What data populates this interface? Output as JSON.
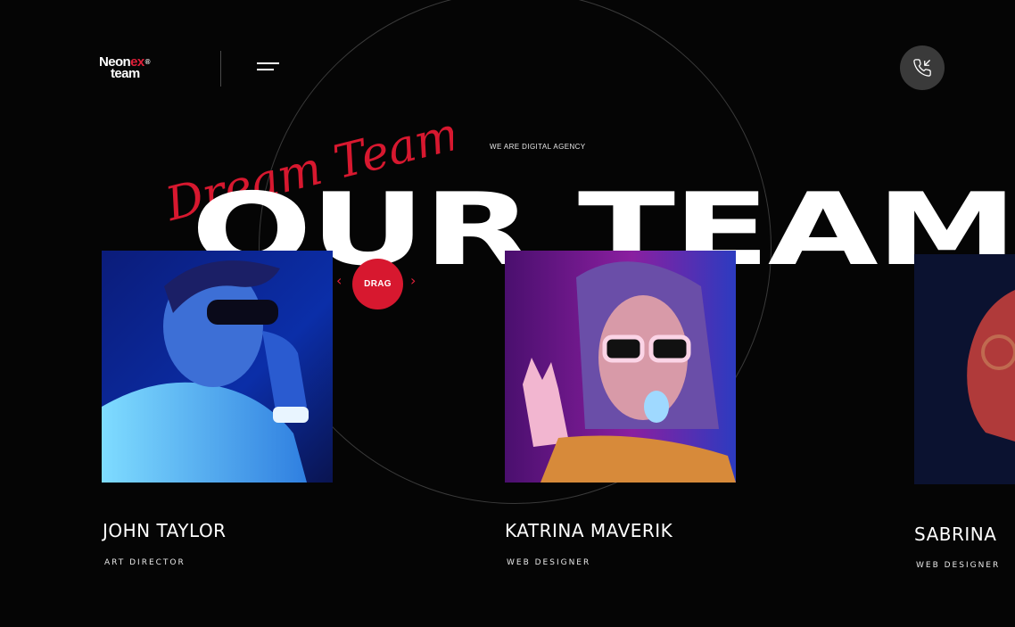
{
  "logo": {
    "part1": "Neon",
    "accent": "ex",
    "reg": "®",
    "part2": "team"
  },
  "header": {
    "menu_icon": "menu-icon",
    "call_icon": "phone-call-icon"
  },
  "hero": {
    "script_text": "Dream Team",
    "tagline": "WE ARE DIGITAL AGENCY",
    "title": "OUR TEAM"
  },
  "slider": {
    "drag_label": "DRAG",
    "prev_icon": "chevron-left-icon",
    "next_icon": "chevron-right-icon"
  },
  "colors": {
    "accent": "#d7182f",
    "background": "#050505",
    "circle_button": "#3a3a3a"
  },
  "team": [
    {
      "name": "JOHN TAYLOR",
      "role": "ART DIRECTOR"
    },
    {
      "name": "KATRINA MAVERIK",
      "role": "WEB DESIGNER"
    },
    {
      "name": "SABRINA",
      "role": "WEB DESIGNER"
    }
  ]
}
